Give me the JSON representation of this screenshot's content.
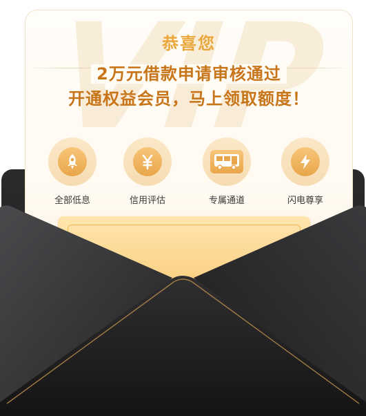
{
  "card": {
    "watermark": "VIP",
    "congrats": "恭喜您",
    "headline_line1": "2万元借款申请审核通过",
    "headline_line2": "开通权益会员，马上领取额度！"
  },
  "benefits": [
    {
      "label": "全部低息",
      "icon": "rocket-icon"
    },
    {
      "label": "信用评估",
      "icon": "yen-icon"
    },
    {
      "label": "专属通道",
      "icon": "bus-icon"
    },
    {
      "label": "闪电尊享",
      "icon": "lightning-icon"
    }
  ],
  "colors": {
    "accent_gold": "#e9a73c",
    "headline_brown": "#c87519",
    "envelope_dark": "#1e1e20"
  }
}
